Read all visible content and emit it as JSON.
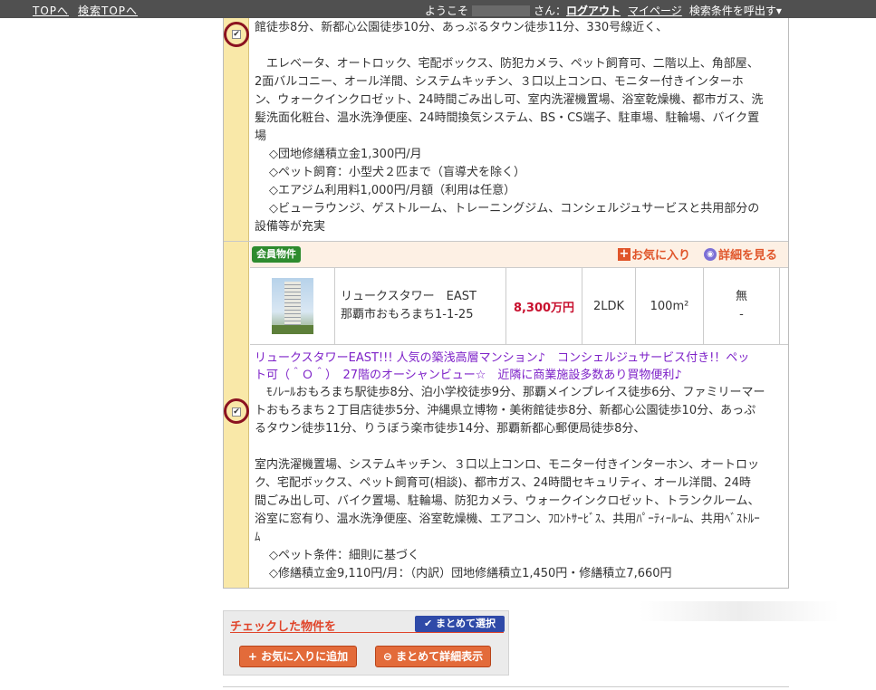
{
  "topbar": {
    "top_link": "TOPへ",
    "search_top_link": "検索TOPへ",
    "welcome": "ようこそ",
    "san": "さん：",
    "logout": "ログアウト",
    "mypage": "マイページ",
    "recall": "検索条件を呼出す▾"
  },
  "listing1": {
    "lines": [
      "館徒歩8分、新都心公園徒歩10分、あっぷるタウン徒歩11分、330号線近く、",
      "",
      "　エレベータ、オートロック、宅配ボックス、防犯カメラ、ペット飼育可、二階以上、角部屋、",
      "2面バルコニー、オール洋間、システムキッチン、３口以上コンロ、モニター付きインターホ",
      "ン、ウォークインクロゼット、24時間ごみ出し可、室内洗濯機置場、浴室乾燥機、都市ガス、洗",
      "髪洗面化粧台、温水洗浄便座、24時間換気システム、BS・CS端子、駐車場、駐輪場、バイク置",
      "場"
    ],
    "notes": [
      "◇団地修繕積立金1,300円/月",
      "◇ペット飼育：小型犬２匹まで（盲導犬を除く）",
      "◇エアジム利用料1,000円/月額（利用は任意）",
      "◇ビューラウンジ、ゲストルーム、トレーニングジム、コンシェルジュサービスと共用部分の"
    ],
    "notes_tail": "設備等が充実",
    "checkbox_mark": "✔"
  },
  "listing2": {
    "badge": "会員物件",
    "fav_label": "お気に入り",
    "detail_label": "詳細を見る",
    "plus_icon": "+",
    "detail_icon": "◉",
    "name": "リュークスタワー　EAST",
    "address": "那覇市おもろまち1-1-25",
    "price": "8,300万円",
    "layout": "2LDK",
    "area": "100m²",
    "cond1": "無",
    "cond2": "-",
    "catch_lines": [
      "リュークスタワーEAST!!! 人気の築浅高層マンション♪　コンシェルジュサービス付き!！ペッ",
      "ト可（＾Ｏ＾）　27階のオーシャンビュー☆　近隣に商業施設多数あり買物便利♪"
    ],
    "access_lines": [
      "　ﾓﾉﾚｰﾙおもろまち駅徒歩8分、泊小学校徒歩9分、那覇メインプレイス徒歩6分、ファミリーマー",
      "トおもろまち２丁目店徒歩5分、沖縄県立博物・美術館徒歩8分、新都心公園徒歩10分、あっぷ",
      "るタウン徒歩11分、りうぼう楽市徒歩14分、那覇新都心郵便局徒歩8分、"
    ],
    "equip_lines": [
      "室内洗濯機置場、システムキッチン、３口以上コンロ、モニター付きインターホン、オートロッ",
      "ク、宅配ボックス、ペット飼育可(相談)、都市ガス、24時間セキュリティ、オール洋間、24時",
      "間ごみ出し可、バイク置場、駐輪場、防犯カメラ、ウォークインクロゼット、トランクルーム、",
      "浴室に窓有り、温水洗浄便座、浴室乾燥機、エアコン、ﾌﾛﾝﾄｻｰﾋﾞｽ、共用ﾊﾟｰﾃｨｰﾙｰﾑ、共用ﾍﾞｽﾄﾙｰ",
      "ﾑ"
    ],
    "notes": [
      "◇ペット条件：細則に基づく",
      "◇修繕積立金9,110円/月：（内訳）団地修繕積立1,450円・修繕積立7,660円"
    ],
    "checkbox_mark": "✔"
  },
  "actions": {
    "title": "チェックした物件を",
    "bulk_select": "✔ まとめて選択",
    "add_fav": "+ お気に入りに追加",
    "bulk_detail": "⊖ まとめて詳細表示"
  }
}
